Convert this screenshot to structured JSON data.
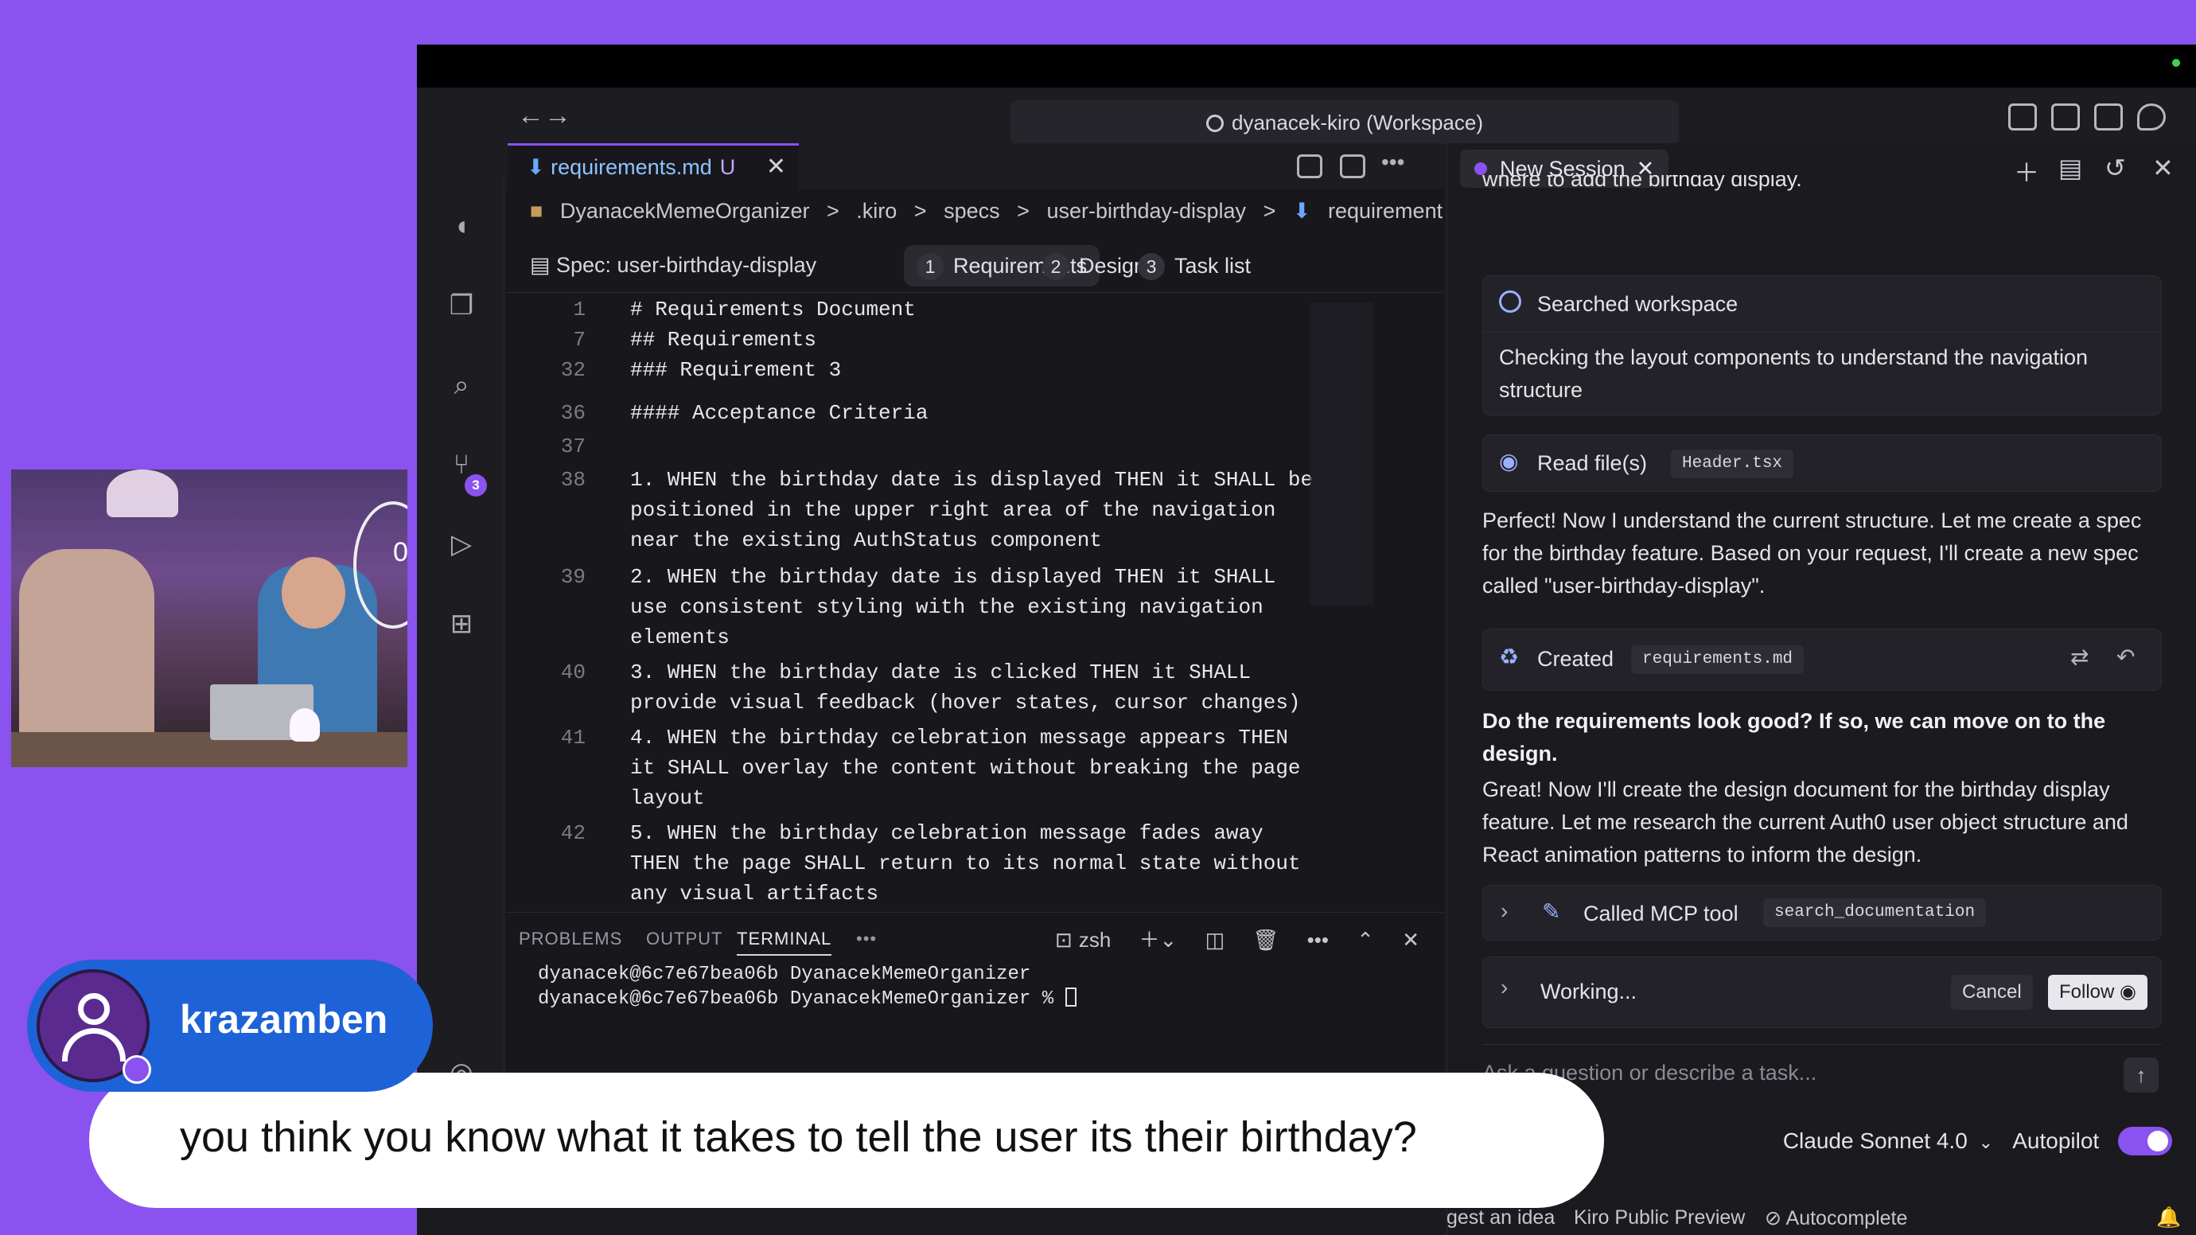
{
  "window": {
    "workspace_title": "dyanacek-kiro (Workspace)"
  },
  "activity": {
    "scm_badge": "3"
  },
  "editor": {
    "tab_label": "requirements.md",
    "tab_status": "U",
    "breadcrumb": [
      "DyanacekMemeOrganizer",
      ">",
      ".kiro",
      ">",
      "specs",
      ">",
      "user-birthday-display",
      ">",
      "requirement"
    ],
    "spec_label": "Spec: user-birthday-display",
    "steps": [
      {
        "num": "1",
        "label": "Requirements"
      },
      {
        "num": "2",
        "label": "Design"
      },
      {
        "num": "3",
        "label": "Task list"
      }
    ],
    "lines": [
      {
        "n": "1",
        "text": "# Requirements Document"
      },
      {
        "n": "7",
        "text": "## Requirements"
      },
      {
        "n": "32",
        "text": "### Requirement 3"
      },
      {
        "n": "36",
        "text": "#### Acceptance Criteria"
      },
      {
        "n": "37",
        "text": ""
      },
      {
        "n": "38",
        "text": "1. WHEN the birthday date is displayed THEN it SHALL be"
      },
      {
        "n": "",
        "text": "positioned in the upper right area of the navigation"
      },
      {
        "n": "",
        "text": "near the existing AuthStatus component"
      },
      {
        "n": "39",
        "text": "2. WHEN the birthday date is displayed THEN it SHALL"
      },
      {
        "n": "",
        "text": "use consistent styling with the existing navigation"
      },
      {
        "n": "",
        "text": "elements"
      },
      {
        "n": "40",
        "text": "3. WHEN the birthday date is clicked THEN it SHALL"
      },
      {
        "n": "",
        "text": "provide visual feedback (hover states, cursor changes)"
      },
      {
        "n": "41",
        "text": "4. WHEN the birthday celebration message appears THEN"
      },
      {
        "n": "",
        "text": "it SHALL overlay the content without breaking the page"
      },
      {
        "n": "",
        "text": "layout"
      },
      {
        "n": "42",
        "text": "5. WHEN the birthday celebration message fades away"
      },
      {
        "n": "",
        "text": "THEN the page SHALL return to its normal state without"
      },
      {
        "n": "",
        "text": "any visual artifacts"
      }
    ]
  },
  "terminal": {
    "tabs": [
      "PROBLEMS",
      "OUTPUT",
      "TERMINAL"
    ],
    "shell": "zsh",
    "line1": "dyanacek@6c7e67bea06b DyanacekMemeOrganizer",
    "line2": "dyanacek@6c7e67bea06b DyanacekMemeOrganizer % "
  },
  "chat": {
    "tab_label": "New Session",
    "clipped_top": "where to add the birthday display.",
    "searched_title": "Searched workspace",
    "searched_body": "Checking the layout components to understand the navigation structure",
    "read_title": "Read file(s)",
    "read_file": "Header.tsx",
    "msg1": "Perfect! Now I understand the current structure. Let me create a spec for the birthday feature. Based on your request, I'll create a new spec called \"user-birthday-display\".",
    "created_title": "Created",
    "created_file": "requirements.md",
    "msg2": "Do the requirements look good? If so, we can move on to the design.",
    "msg3": "Great! Now I'll create the design document for the birthday display feature. Let me research the current Auth0 user object structure and React animation patterns to inform the design.",
    "mcp_title": "Called MCP tool",
    "mcp_tool": "search_documentation",
    "working_label": "Working...",
    "cancel_label": "Cancel",
    "follow_label": "Follow",
    "input_placeholder": "Ask a question or describe a task...",
    "model": "Claude Sonnet 4.0",
    "autopilot_label": "Autopilot"
  },
  "status": {
    "suggest": "gest an idea",
    "preview": "Kiro Public Preview",
    "autocomplete": "Autocomplete"
  },
  "overlay": {
    "username": "krazamben",
    "caption": "you think you know what it takes to tell the user its their birthday?",
    "webcam_counter": "0"
  },
  "colors": {
    "brand": "#8a52ef",
    "user_pill": "#1e62d8"
  }
}
